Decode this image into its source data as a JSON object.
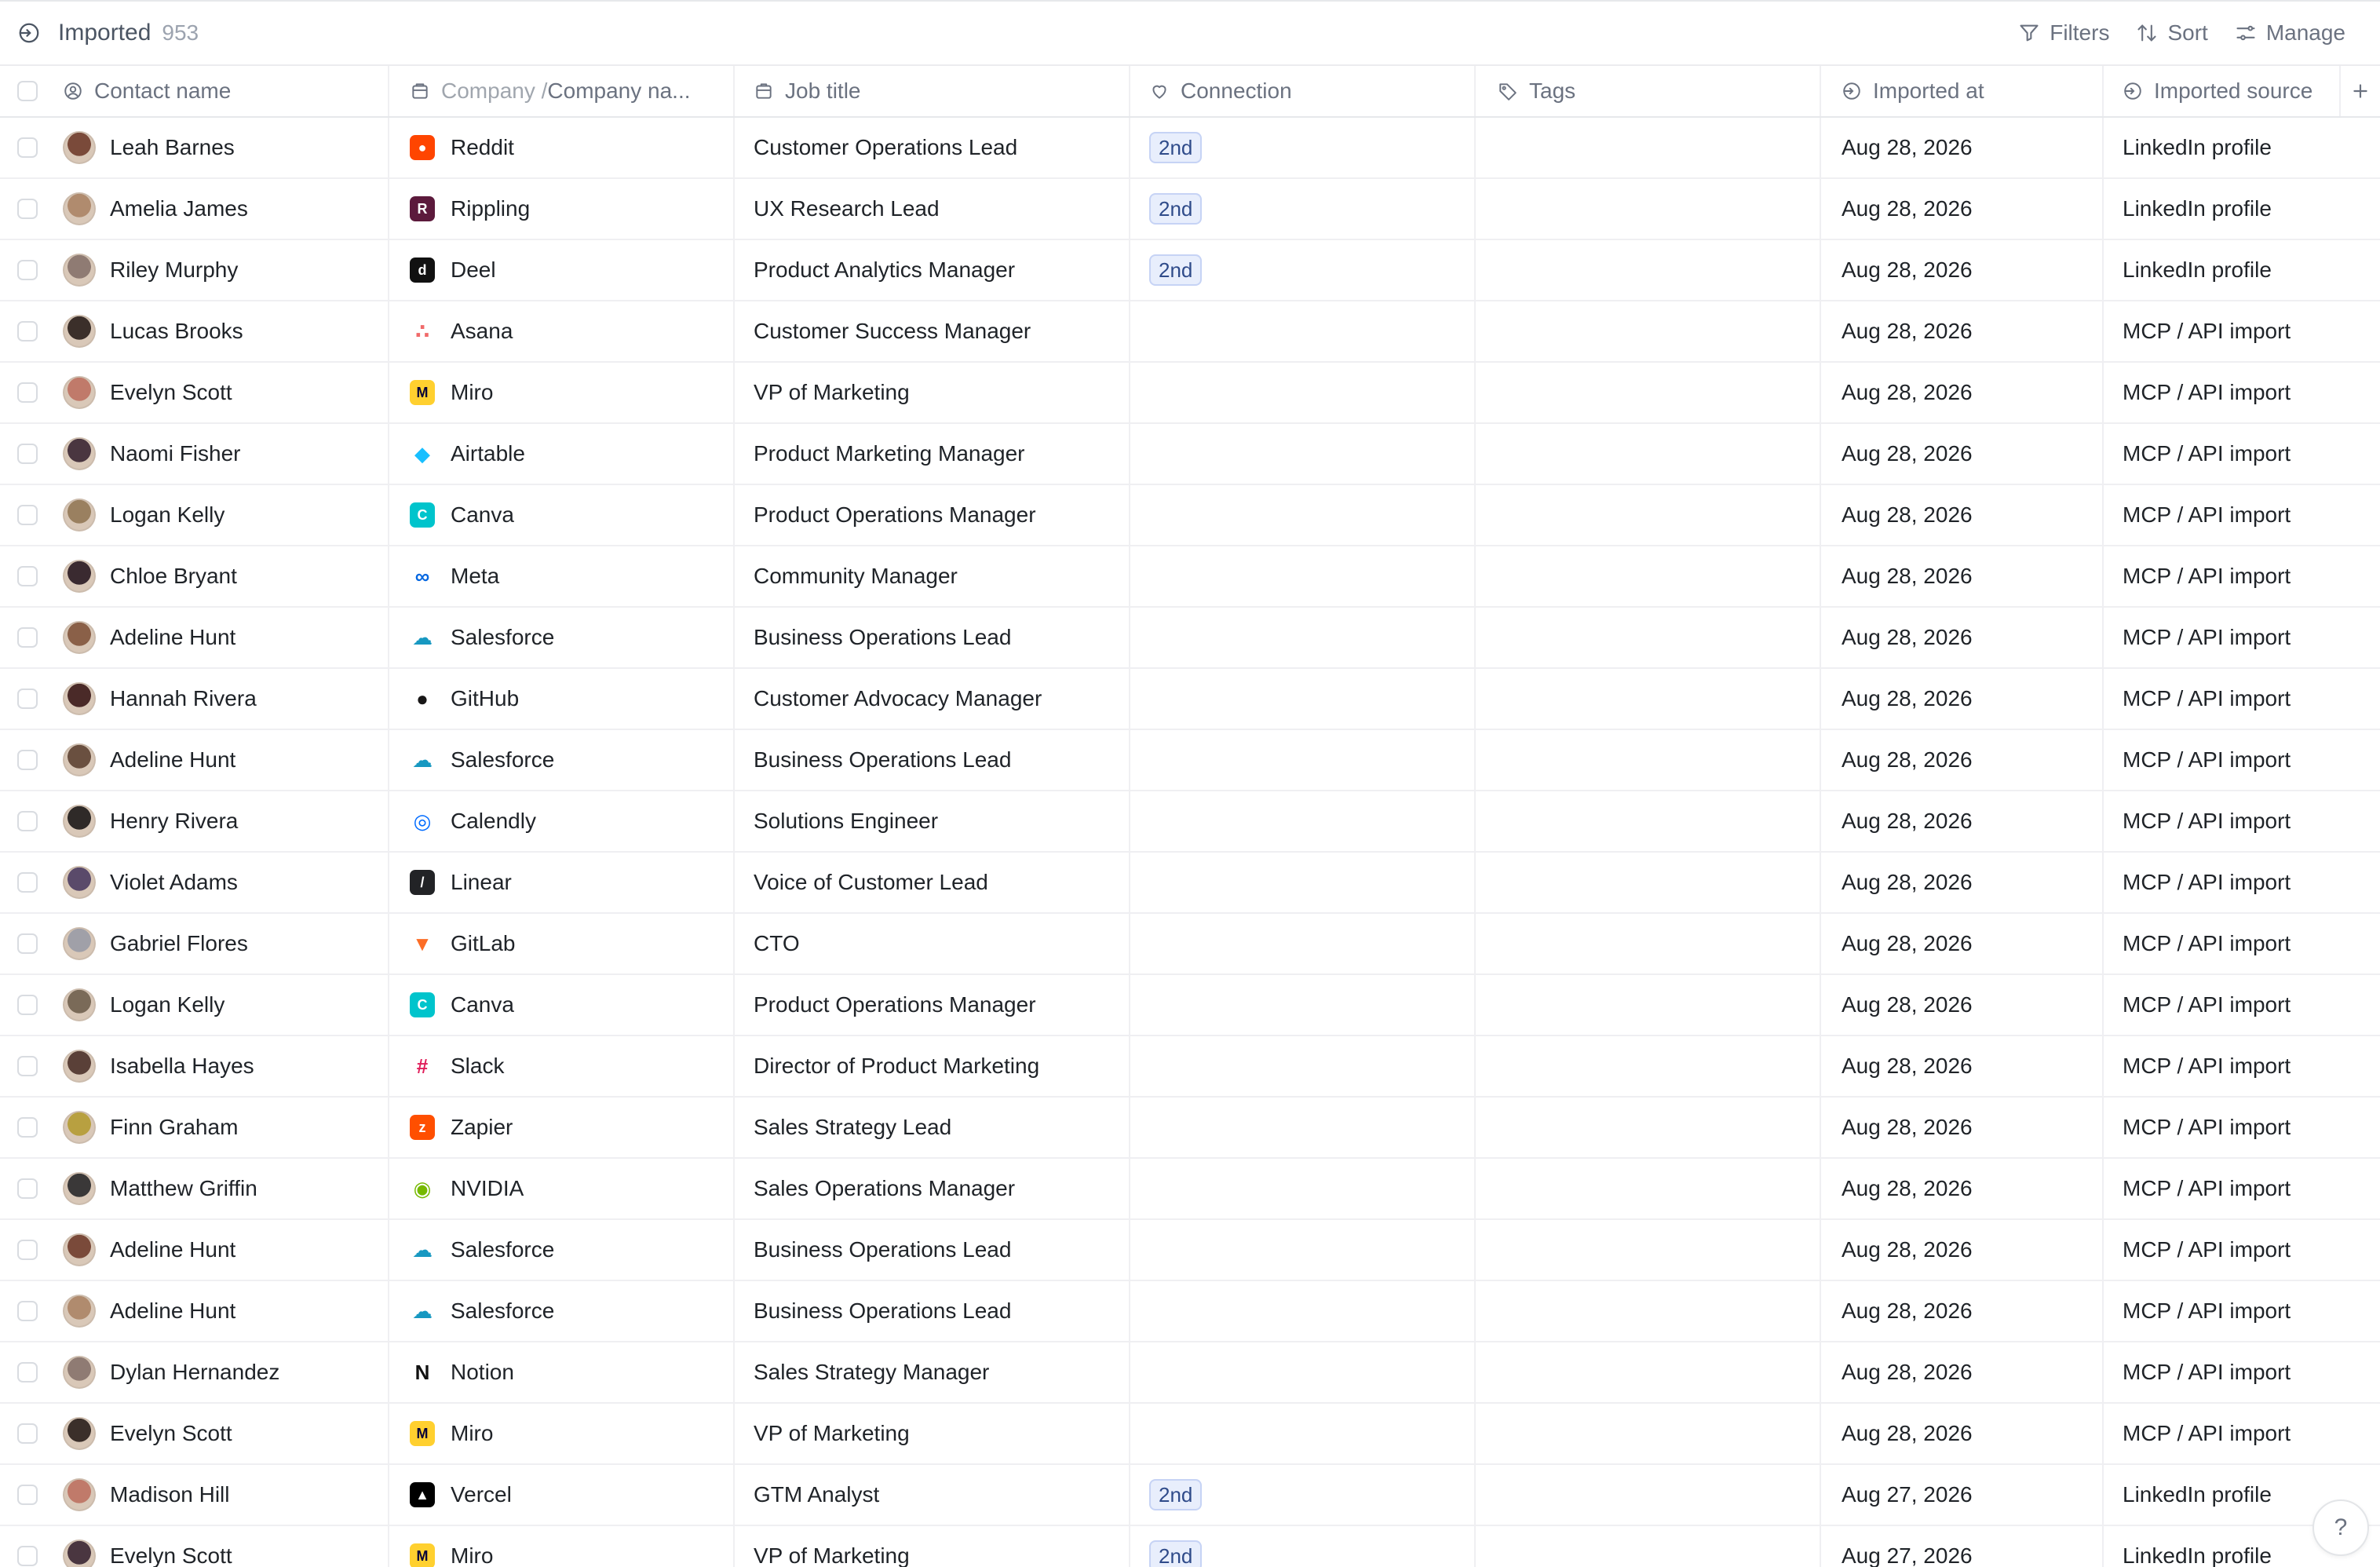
{
  "header": {
    "title": "Imported",
    "count": "953",
    "filters_label": "Filters",
    "sort_label": "Sort",
    "manage_label": "Manage"
  },
  "columns": {
    "contact": "Contact name",
    "company_prefix": "Company / ",
    "company": "Company na...",
    "job": "Job title",
    "connection": "Connection",
    "tags": "Tags",
    "imported_at": "Imported at",
    "source": "Imported source"
  },
  "rows": [
    {
      "name": "Leah Barnes",
      "company": "Reddit",
      "job": "Customer Operations Lead",
      "connection": "2nd",
      "date": "Aug 28, 2026",
      "source": "LinkedIn profile"
    },
    {
      "name": "Amelia James",
      "company": "Rippling",
      "job": "UX Research Lead",
      "connection": "2nd",
      "date": "Aug 28, 2026",
      "source": "LinkedIn profile"
    },
    {
      "name": "Riley Murphy",
      "company": "Deel",
      "job": "Product Analytics Manager",
      "connection": "2nd",
      "date": "Aug 28, 2026",
      "source": "LinkedIn profile"
    },
    {
      "name": "Lucas Brooks",
      "company": "Asana",
      "job": "Customer Success Manager",
      "connection": "",
      "date": "Aug 28, 2026",
      "source": "MCP / API import"
    },
    {
      "name": "Evelyn Scott",
      "company": "Miro",
      "job": "VP of Marketing",
      "connection": "",
      "date": "Aug 28, 2026",
      "source": "MCP / API import"
    },
    {
      "name": "Naomi Fisher",
      "company": "Airtable",
      "job": "Product Marketing Manager",
      "connection": "",
      "date": "Aug 28, 2026",
      "source": "MCP / API import"
    },
    {
      "name": "Logan Kelly",
      "company": "Canva",
      "job": "Product Operations Manager",
      "connection": "",
      "date": "Aug 28, 2026",
      "source": "MCP / API import"
    },
    {
      "name": "Chloe Bryant",
      "company": "Meta",
      "job": "Community Manager",
      "connection": "",
      "date": "Aug 28, 2026",
      "source": "MCP / API import"
    },
    {
      "name": "Adeline Hunt",
      "company": "Salesforce",
      "job": "Business Operations Lead",
      "connection": "",
      "date": "Aug 28, 2026",
      "source": "MCP / API import"
    },
    {
      "name": "Hannah Rivera",
      "company": "GitHub",
      "job": "Customer Advocacy Manager",
      "connection": "",
      "date": "Aug 28, 2026",
      "source": "MCP / API import"
    },
    {
      "name": "Adeline Hunt",
      "company": "Salesforce",
      "job": "Business Operations Lead",
      "connection": "",
      "date": "Aug 28, 2026",
      "source": "MCP / API import"
    },
    {
      "name": "Henry Rivera",
      "company": "Calendly",
      "job": "Solutions Engineer",
      "connection": "",
      "date": "Aug 28, 2026",
      "source": "MCP / API import"
    },
    {
      "name": "Violet Adams",
      "company": "Linear",
      "job": "Voice of Customer Lead",
      "connection": "",
      "date": "Aug 28, 2026",
      "source": "MCP / API import"
    },
    {
      "name": "Gabriel Flores",
      "company": "GitLab",
      "job": "CTO",
      "connection": "",
      "date": "Aug 28, 2026",
      "source": "MCP / API import"
    },
    {
      "name": "Logan Kelly",
      "company": "Canva",
      "job": "Product Operations Manager",
      "connection": "",
      "date": "Aug 28, 2026",
      "source": "MCP / API import"
    },
    {
      "name": "Isabella Hayes",
      "company": "Slack",
      "job": "Director of Product Marketing",
      "connection": "",
      "date": "Aug 28, 2026",
      "source": "MCP / API import"
    },
    {
      "name": "Finn Graham",
      "company": "Zapier",
      "job": "Sales Strategy Lead",
      "connection": "",
      "date": "Aug 28, 2026",
      "source": "MCP / API import"
    },
    {
      "name": "Matthew Griffin",
      "company": "NVIDIA",
      "job": "Sales Operations Manager",
      "connection": "",
      "date": "Aug 28, 2026",
      "source": "MCP / API import"
    },
    {
      "name": "Adeline Hunt",
      "company": "Salesforce",
      "job": "Business Operations Lead",
      "connection": "",
      "date": "Aug 28, 2026",
      "source": "MCP / API import"
    },
    {
      "name": "Adeline Hunt",
      "company": "Salesforce",
      "job": "Business Operations Lead",
      "connection": "",
      "date": "Aug 28, 2026",
      "source": "MCP / API import"
    },
    {
      "name": "Dylan Hernandez",
      "company": "Notion",
      "job": "Sales Strategy Manager",
      "connection": "",
      "date": "Aug 28, 2026",
      "source": "MCP / API import"
    },
    {
      "name": "Evelyn Scott",
      "company": "Miro",
      "job": "VP of Marketing",
      "connection": "",
      "date": "Aug 28, 2026",
      "source": "MCP / API import"
    },
    {
      "name": "Madison Hill",
      "company": "Vercel",
      "job": "GTM Analyst",
      "connection": "2nd",
      "date": "Aug 27, 2026",
      "source": "LinkedIn profile"
    },
    {
      "name": "Evelyn Scott",
      "company": "Miro",
      "job": "VP of Marketing",
      "connection": "2nd",
      "date": "Aug 27, 2026",
      "source": "LinkedIn profile"
    }
  ],
  "help_label": "?"
}
